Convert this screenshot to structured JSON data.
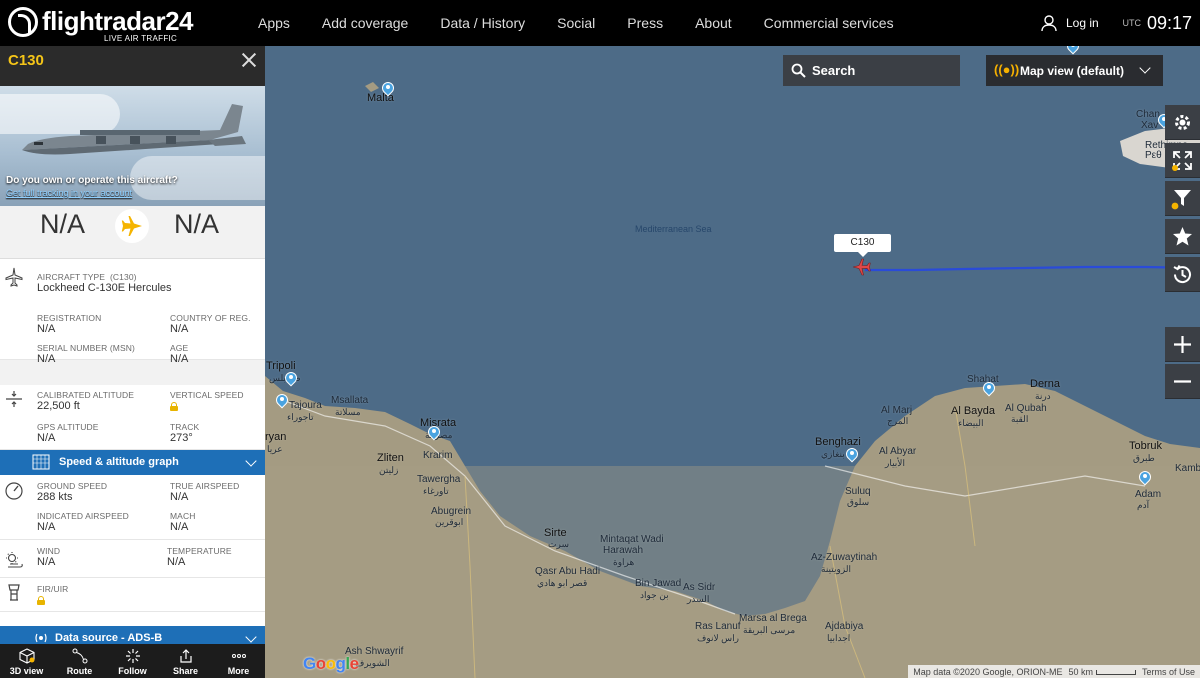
{
  "topbar": {
    "logo_text": "flightradar24",
    "logo_sub": "LIVE AIR TRAFFIC",
    "nav": [
      "Apps",
      "Add coverage",
      "Data / History",
      "Social",
      "Press",
      "About",
      "Commercial services"
    ],
    "login": "Log in",
    "tz": "UTC",
    "time": "09:17"
  },
  "panel": {
    "callsign": "C130",
    "promo": "Do you own or operate this aircraft?",
    "promo_link": "Get full tracking in your account",
    "origin": "N/A",
    "destination": "N/A",
    "aircraft": {
      "type_label": "AIRCRAFT TYPE",
      "type_code": "(C130)",
      "type_value": "Lockheed C-130E Hercules",
      "reg_label": "REGISTRATION",
      "reg_value": "N/A",
      "country_label": "COUNTRY OF REG.",
      "country_value": "N/A",
      "serial_label": "SERIAL NUMBER (MSN)",
      "serial_value": "N/A",
      "age_label": "AGE",
      "age_value": "N/A"
    },
    "altitude": {
      "cal_label": "CALIBRATED ALTITUDE",
      "cal_value": "22,500 ft",
      "vs_label": "VERTICAL SPEED",
      "gps_label": "GPS ALTITUDE",
      "gps_value": "N/A",
      "track_label": "TRACK",
      "track_value": "273°"
    },
    "graph_bar": "Speed & altitude graph",
    "speed": {
      "gs_label": "GROUND SPEED",
      "gs_value": "288 kts",
      "tas_label": "TRUE AIRSPEED",
      "tas_value": "N/A",
      "ias_label": "INDICATED AIRSPEED",
      "ias_value": "N/A",
      "mach_label": "MACH",
      "mach_value": "N/A"
    },
    "weather": {
      "wind_label": "WIND",
      "wind_value": "N/A",
      "temp_label": "TEMPERATURE",
      "temp_value": "N/A"
    },
    "fir_label": "FIR/UIR",
    "data_source_bar": "Data source - ADS-B",
    "bottom": [
      "3D view",
      "Route",
      "Follow",
      "Share",
      "More"
    ]
  },
  "map": {
    "search": "Search",
    "map_view": "Map view (default)",
    "sea_label": "Mediterranean Sea",
    "flight_label": "C130",
    "places": [
      {
        "name": "Malta",
        "big": true
      },
      {
        "name": "Tripoli",
        "big": true
      },
      {
        "name": "طرابلس"
      },
      {
        "name": "Tajoura"
      },
      {
        "name": "تاجوراء"
      },
      {
        "name": "Msallata"
      },
      {
        "name": "مسلاتة"
      },
      {
        "name": "Misrata",
        "big": true
      },
      {
        "name": "مصراتة"
      },
      {
        "name": "Zliten",
        "big": true
      },
      {
        "name": "زليتن"
      },
      {
        "name": "Krarim"
      },
      {
        "name": "Tawergha"
      },
      {
        "name": "تاورغاء"
      },
      {
        "name": "Abugrein"
      },
      {
        "name": "ابوقرين"
      },
      {
        "name": "Sirte",
        "big": true
      },
      {
        "name": "سرت"
      },
      {
        "name": "Qasr Abu Hadi"
      },
      {
        "name": "قصر ابو هادي"
      },
      {
        "name": "Mintaqat Wadi"
      },
      {
        "name": "Harawah"
      },
      {
        "name": "هراوة"
      },
      {
        "name": "Bin Jawad"
      },
      {
        "name": "بن جواد"
      },
      {
        "name": "As Sidr"
      },
      {
        "name": "السدر"
      },
      {
        "name": "Ras Lanuf"
      },
      {
        "name": "راس لانوف"
      },
      {
        "name": "Marsa al Brega"
      },
      {
        "name": "مرسى البريقة"
      },
      {
        "name": "Ajdabiya"
      },
      {
        "name": "اجدابيا"
      },
      {
        "name": "Ash Shwayrif"
      },
      {
        "name": "الشويرف"
      },
      {
        "name": "Benghazi",
        "big": true
      },
      {
        "name": "بنغازي"
      },
      {
        "name": "Al Abyar"
      },
      {
        "name": "الأبيار"
      },
      {
        "name": "Suluq"
      },
      {
        "name": "سلوق"
      },
      {
        "name": "Az-Zuwaytinah"
      },
      {
        "name": "الزويتينة"
      },
      {
        "name": "Al Marj"
      },
      {
        "name": "المرج"
      },
      {
        "name": "Al Bayda",
        "big": true
      },
      {
        "name": "البيضاء"
      },
      {
        "name": "Shahat"
      },
      {
        "name": "Al Qubah"
      },
      {
        "name": "القبة"
      },
      {
        "name": "Derna",
        "big": true
      },
      {
        "name": "درنة"
      },
      {
        "name": "Tobruk",
        "big": true
      },
      {
        "name": "طبرق"
      },
      {
        "name": "Adam"
      },
      {
        "name": "آدم"
      },
      {
        "name": "Kamb"
      },
      {
        "name": "Chan"
      },
      {
        "name": "Xav"
      },
      {
        "name": "Rethimno"
      },
      {
        "name": "Ρεθ"
      },
      {
        "name": "ryan"
      },
      {
        "name": "عريا"
      }
    ],
    "google": "Google",
    "attrib_data": "Map data ©2020 Google, ORION-ME",
    "attrib_scale": "50 km",
    "attrib_terms": "Terms of Use"
  }
}
